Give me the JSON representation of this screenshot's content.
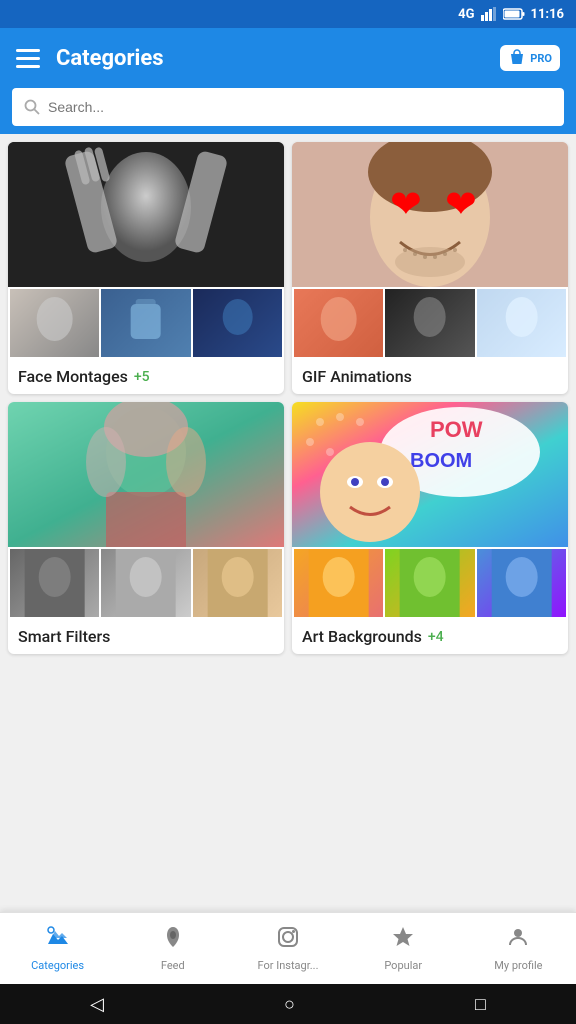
{
  "statusBar": {
    "signal": "4G",
    "bars": "▲",
    "battery": "🔋",
    "time": "11:16"
  },
  "toolbar": {
    "title": "Categories",
    "proBadge": "PRO"
  },
  "searchBar": {
    "placeholder": "Search..."
  },
  "categories": [
    {
      "id": "face-montages",
      "label": "Face Montages",
      "count": "+5",
      "hasCount": true
    },
    {
      "id": "gif-animations",
      "label": "GIF Animations",
      "count": "",
      "hasCount": false
    },
    {
      "id": "smart-filters",
      "label": "Smart Filters",
      "count": "",
      "hasCount": false
    },
    {
      "id": "art-backgrounds",
      "label": "Art Backgrounds",
      "count": "+4",
      "hasCount": true
    }
  ],
  "bottomNav": {
    "items": [
      {
        "id": "categories",
        "label": "Categories",
        "icon": "✦",
        "active": true
      },
      {
        "id": "feed",
        "label": "Feed",
        "icon": "🔥",
        "active": false
      },
      {
        "id": "instagram",
        "label": "For Instagr...",
        "icon": "⬡",
        "active": false
      },
      {
        "id": "popular",
        "label": "Popular",
        "icon": "★",
        "active": false
      },
      {
        "id": "profile",
        "label": "My profile",
        "icon": "👤",
        "active": false
      }
    ]
  },
  "systemNav": {
    "back": "◁",
    "home": "○",
    "recent": "□"
  }
}
